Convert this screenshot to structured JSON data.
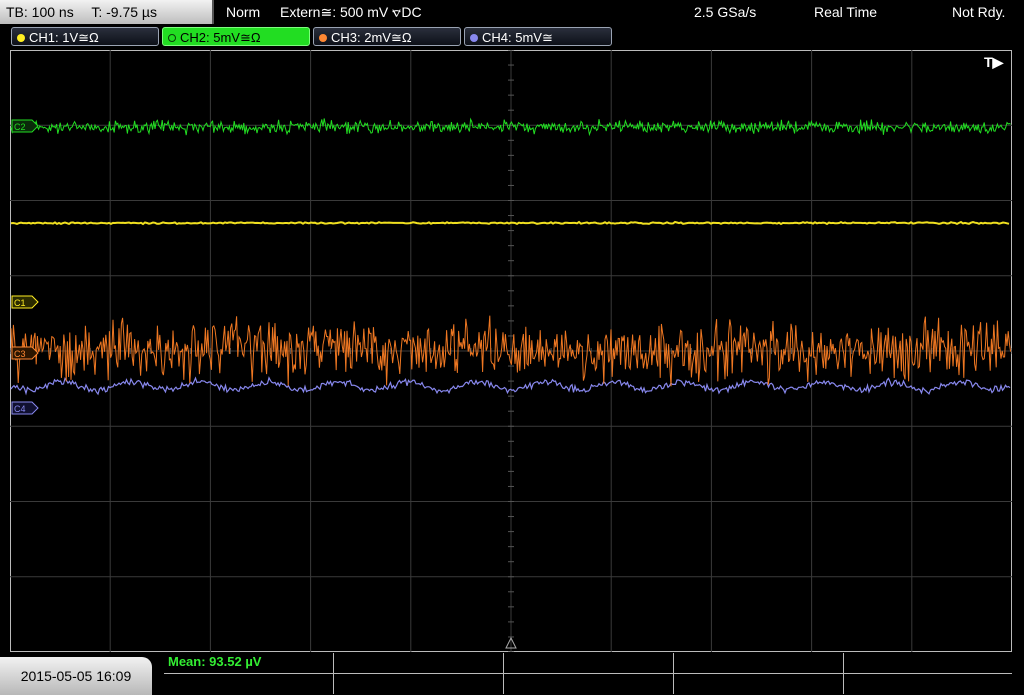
{
  "top_bar": {
    "timebase": "TB: 100 ns",
    "trigger_time": "T: -9.75 µs",
    "trigger_mode": "Norm",
    "trigger_source": "Extern≅: 500 mV ⦡DC",
    "sample_rate": "2.5 GSa/s",
    "acq_mode": "Real Time",
    "trigger_status": "Not Rdy."
  },
  "channels": [
    {
      "label": "CH1: 1V≅Ω",
      "color": "#ffee22",
      "active": false
    },
    {
      "label": "CH2: 5mV≅Ω",
      "color": "#22dd22",
      "active": true
    },
    {
      "label": "CH3: 2mV≅Ω",
      "color": "#ff8833",
      "active": false
    },
    {
      "label": "CH4: 5mV≅",
      "color": "#8888ee",
      "active": false
    }
  ],
  "markers": {
    "trigger": "T▶",
    "c1": "C1",
    "c2": "C2",
    "c3": "C3",
    "c4": "C4"
  },
  "footer": {
    "datetime": "2015-05-05 16:09",
    "measurement": "Mean: 93.52 µV"
  }
}
